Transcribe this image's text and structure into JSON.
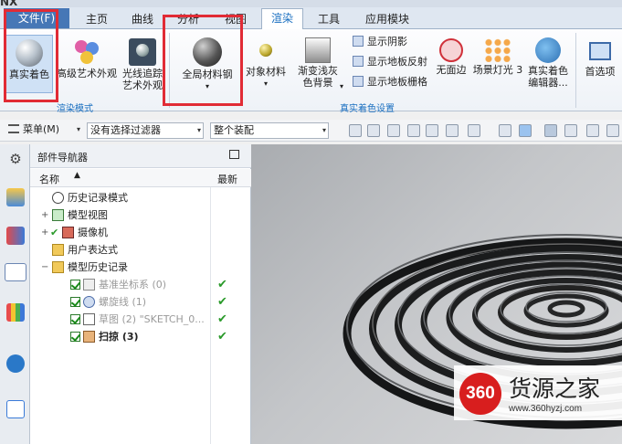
{
  "title_strip": {
    "app": "NX"
  },
  "menu_tabs": [
    {
      "label": "文件(F)"
    },
    {
      "label": "主页"
    },
    {
      "label": "曲线"
    },
    {
      "label": "分析"
    },
    {
      "label": "视图"
    },
    {
      "label": "渲染"
    },
    {
      "label": "工具"
    },
    {
      "label": "应用模块"
    }
  ],
  "ribbon": {
    "true_shading": "真实着色",
    "advanced_art": "高级艺术外观",
    "raytrace_line1": "光线追踪",
    "raytrace_line2": "艺术外观",
    "global_material": "全局材料钢",
    "object_material": "对象材料",
    "gradient_line1": "渐变浅灰",
    "gradient_line2": "色背景",
    "show_shadow": "显示阴影",
    "show_floor_reflect": "显示地板反射",
    "show_floor_grid": "显示地板栅格",
    "no_edge": "无面边",
    "scene_light": "场景灯光 3",
    "true_shade_editor_line1": "真实着色",
    "true_shade_editor_line2": "编辑器...",
    "preferences": "首选项",
    "group_render_mode": "渲染模式",
    "group_true_shade_settings": "真实着色设置"
  },
  "toolbar": {
    "menu_label": "菜单(M)",
    "filter_select": "没有选择过滤器",
    "assembly_select": "整个装配"
  },
  "navigator": {
    "title": "部件导航器",
    "col_name": "名称",
    "col_latest": "最新",
    "rows": [
      {
        "label": "历史记录模式"
      },
      {
        "label": "模型视图"
      },
      {
        "label": "摄像机"
      },
      {
        "label": "用户表达式"
      },
      {
        "label": "模型历史记录"
      },
      {
        "label": "基准坐标系 (0)"
      },
      {
        "label": "螺旋线 (1)"
      },
      {
        "label": "草图 (2) \"SKETCH_0..."
      },
      {
        "label": "扫掠 (3)"
      }
    ]
  },
  "watermark": {
    "logo": "360",
    "brand": "货源之家",
    "url": "www.360hyzj.com"
  },
  "colors": {
    "accent_blue": "#4677b6",
    "highlight_red": "#e12b35",
    "check_green": "#2a9a2a"
  }
}
